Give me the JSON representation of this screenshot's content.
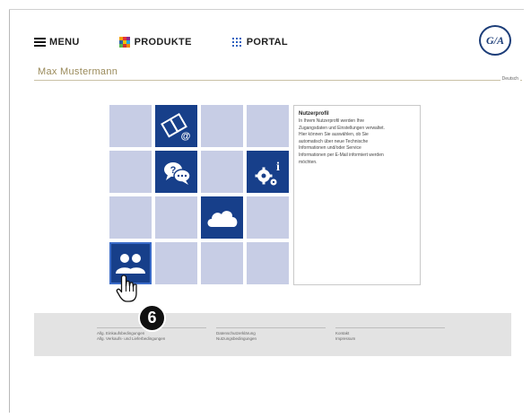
{
  "nav": {
    "menu_label": "MENU",
    "produkte_label": "PRODUKTE",
    "portal_label": "PORTAL"
  },
  "logo": {
    "text": "G/A"
  },
  "user": {
    "name": "Max Mustermann"
  },
  "language": "Deutsch",
  "info_panel": {
    "title": "Nutzerprofil",
    "lines": [
      "In Ihrem Nutzerprofil werden Ihre",
      "Zugangsdaten und Einstellungen verwaltet.",
      "Hier können Sie auswählen, ob Sie",
      "automatisch über neue Technische",
      "Informationen und/oder Service",
      "Informationen per E-Mail informiert werden",
      "möchten."
    ]
  },
  "tiles": [
    {
      "state": "light"
    },
    {
      "state": "dark",
      "icon": "manual-email-icon"
    },
    {
      "state": "light"
    },
    {
      "state": "light"
    },
    {
      "state": "light"
    },
    {
      "state": "dark",
      "icon": "chat-help-icon"
    },
    {
      "state": "light"
    },
    {
      "state": "dark",
      "icon": "settings-info-icon"
    },
    {
      "state": "light"
    },
    {
      "state": "light"
    },
    {
      "state": "dark",
      "icon": "cloud-icon"
    },
    {
      "state": "light"
    },
    {
      "state": "dark",
      "icon": "user-profile-icon",
      "selected": true
    },
    {
      "state": "light"
    },
    {
      "state": "light"
    },
    {
      "state": "light"
    }
  ],
  "step_number": "6",
  "footer": {
    "col1": [
      "Allg. Einkaufsbedingungen",
      "Allg. Verkaufs- und Lieferbedingungen"
    ],
    "col2": [
      "Datenschutzerklärung",
      "Nutzungsbedingungen"
    ],
    "col3": [
      "Kontakt",
      "Impressum"
    ]
  },
  "colors": {
    "tile_light": "#c7cde5",
    "tile_dark": "#173f8a",
    "brand_navy": "#1c3d78",
    "username": "#9a8a5a"
  }
}
